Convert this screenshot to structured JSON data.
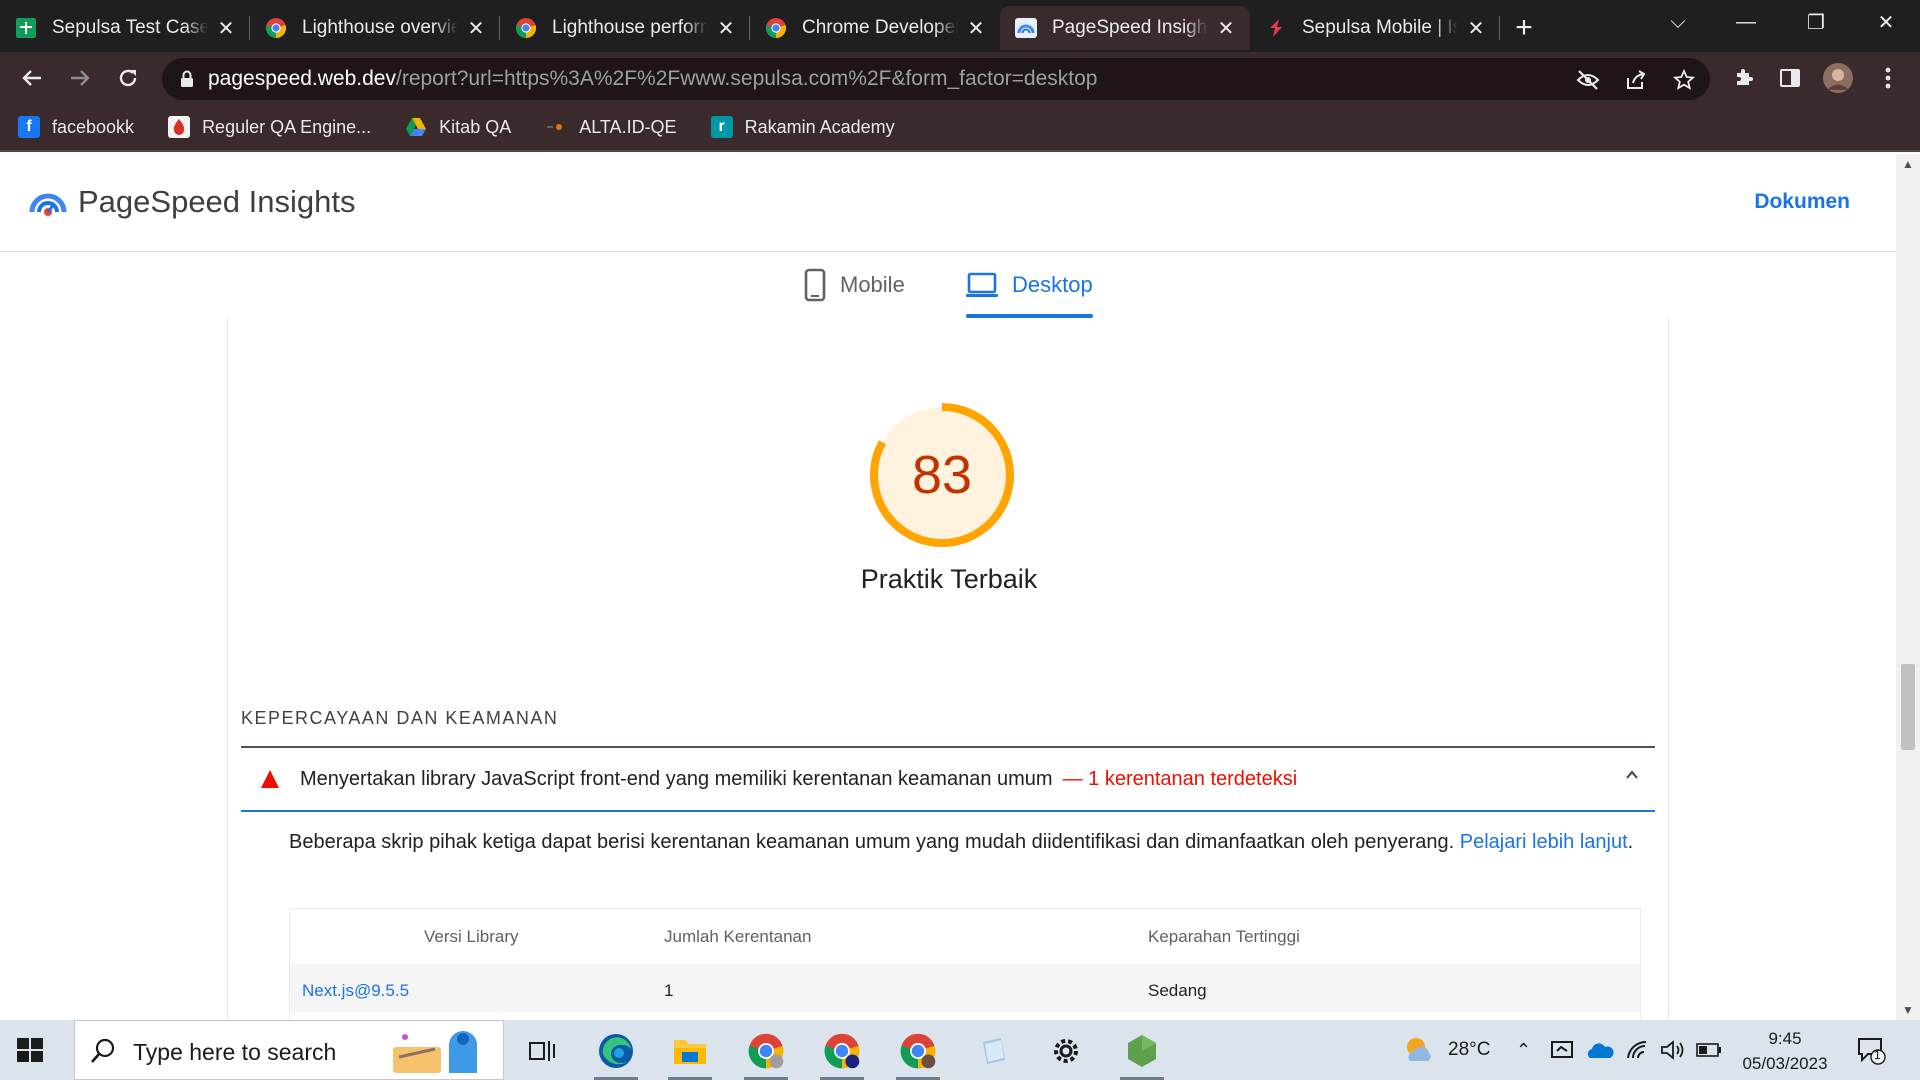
{
  "tabs": [
    {
      "title": "Sepulsa Test Case_E",
      "icon": "sheets-icon",
      "active": false
    },
    {
      "title": "Lighthouse overview",
      "icon": "chrome-icon",
      "active": false
    },
    {
      "title": "Lighthouse perform",
      "icon": "chrome-icon",
      "active": false
    },
    {
      "title": "Chrome Developers",
      "icon": "chrome-icon",
      "active": false
    },
    {
      "title": "PageSpeed Insights",
      "icon": "pagespeed-icon",
      "active": true
    },
    {
      "title": "Sepulsa Mobile | Isi",
      "icon": "sepulsa-icon",
      "active": false
    }
  ],
  "newtab_label": "+",
  "url": {
    "host": "pagespeed.web.dev",
    "path": "/report?url=https%3A%2F%2Fwww.sepulsa.com%2F&form_factor=desktop"
  },
  "bookmarks": [
    {
      "label": "facebookk",
      "icon": "facebook-icon",
      "color": "#1877f2",
      "glyph": "f"
    },
    {
      "label": "Reguler QA Engine...",
      "icon": "bookmark-site-icon",
      "color": "#d93025",
      "glyph": ""
    },
    {
      "label": "Kitab QA",
      "icon": "drive-icon",
      "color": "#f4b400",
      "glyph": ""
    },
    {
      "label": "ALTA.ID-QE",
      "icon": "alta-icon",
      "color": "#e8710a",
      "glyph": ""
    },
    {
      "label": "Rakamin Academy",
      "icon": "rakamin-icon",
      "color": "#0097a7",
      "glyph": "r"
    }
  ],
  "psi": {
    "title": "PageSpeed Insights",
    "doc_link": "Dokumen",
    "device_tabs": [
      {
        "label": "Mobile",
        "active": false
      },
      {
        "label": "Desktop",
        "active": true
      }
    ]
  },
  "score": {
    "value": "83",
    "fraction": 0.83,
    "label": "Praktik Terbaik",
    "color": "#ffa400",
    "text_color": "#c33300"
  },
  "section": {
    "title": "KEPERCAYAAN DAN KEAMANAN"
  },
  "audit": {
    "title": "Menyertakan library JavaScript front-end yang memiliki kerentanan keamanan umum",
    "display_value": "— 1 kerentanan terdeteksi",
    "description": "Beberapa skrip pihak ketiga dapat berisi kerentanan keamanan umum yang mudah diidentifikasi dan dimanfaatkan oleh penyerang. ",
    "learn_more": "Pelajari lebih lanjut",
    "description_end": "."
  },
  "table": {
    "headers": [
      "Versi Library",
      "Jumlah Kerentanan",
      "Keparahan Tertinggi"
    ],
    "rows": [
      {
        "library": "Next.js@9.5.5",
        "count": "1",
        "severity": "Sedang"
      }
    ]
  },
  "taskbar": {
    "search_placeholder": "Type here to search",
    "weather": "28°C",
    "time": "9:45",
    "date": "05/03/2023",
    "notification_count": "1"
  }
}
